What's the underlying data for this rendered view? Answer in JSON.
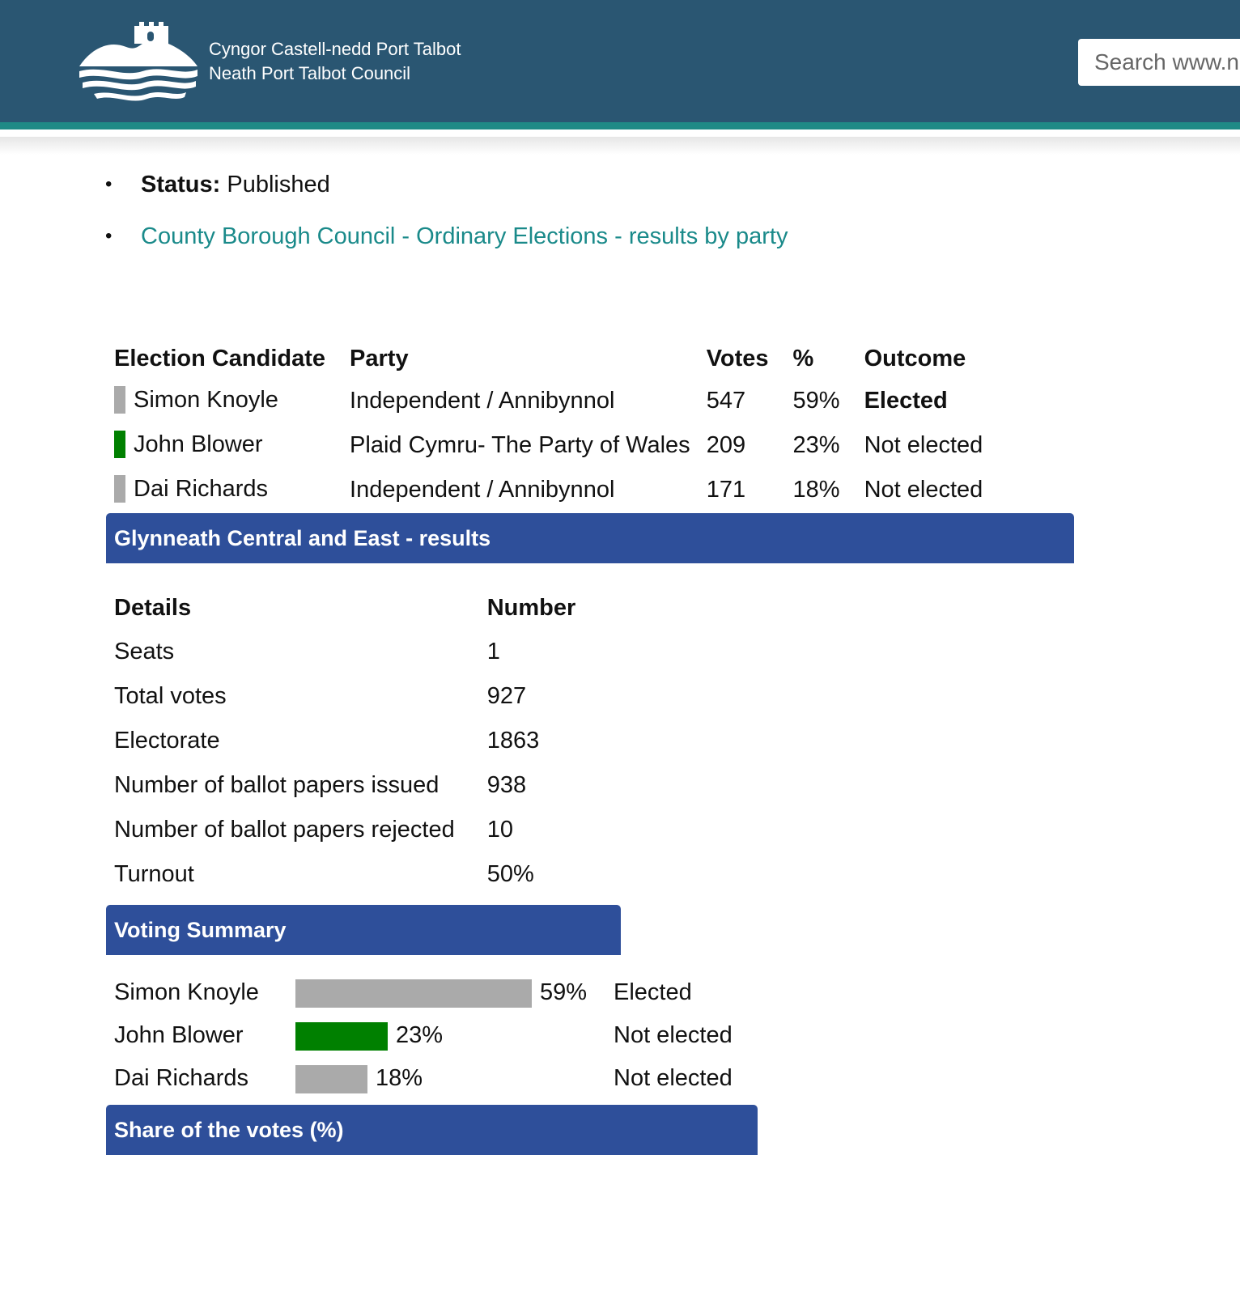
{
  "header": {
    "brand_line1": "Cyngor Castell-nedd Port Talbot",
    "brand_line2": "Neath Port Talbot Council",
    "search_placeholder": "Search www.npt.gov.uk",
    "colors": {
      "header_bg": "#2a5672",
      "header_border": "#1f8a86"
    }
  },
  "meta": {
    "status_label": "Status:",
    "status_value": "Published",
    "link_text": "County Borough Council - Ordinary Elections - results by party"
  },
  "results": {
    "caption": "Glynneath Central and East - results",
    "headers": {
      "candidate": "Election Candidate",
      "party": "Party",
      "votes": "Votes",
      "pct": "%",
      "outcome": "Outcome"
    },
    "rows": [
      {
        "candidate": "Simon Knoyle",
        "party": "Independent / Annibynnol",
        "votes": "547",
        "pct": "59%",
        "outcome": "Elected",
        "color": "#aaaaaa"
      },
      {
        "candidate": "John Blower",
        "party": "Plaid Cymru- The Party of Wales",
        "votes": "209",
        "pct": "23%",
        "outcome": "Not elected",
        "color": "#008000"
      },
      {
        "candidate": "Dai Richards",
        "party": "Independent / Annibynnol",
        "votes": "171",
        "pct": "18%",
        "outcome": "Not elected",
        "color": "#aaaaaa"
      }
    ]
  },
  "details": {
    "caption": "Voting Summary",
    "headers": {
      "details": "Details",
      "number": "Number"
    },
    "rows": [
      {
        "label": "Seats",
        "value": "1"
      },
      {
        "label": "Total votes",
        "value": "927"
      },
      {
        "label": "Electorate",
        "value": "1863"
      },
      {
        "label": "Number of ballot papers issued",
        "value": "938"
      },
      {
        "label": "Number of ballot papers rejected",
        "value": "10"
      },
      {
        "label": "Turnout",
        "value": "50%"
      }
    ]
  },
  "share": {
    "caption": "Share of the votes (%)",
    "rows": [
      {
        "name": "Simon Knoyle",
        "percent": 59,
        "label": "59%",
        "outcome": "Elected",
        "color": "#aaaaaa"
      },
      {
        "name": "John Blower",
        "percent": 23,
        "label": "23%",
        "outcome": "Not elected",
        "color": "#008000"
      },
      {
        "name": "Dai Richards",
        "percent": 18,
        "label": "18%",
        "outcome": "Not elected",
        "color": "#aaaaaa"
      }
    ]
  }
}
